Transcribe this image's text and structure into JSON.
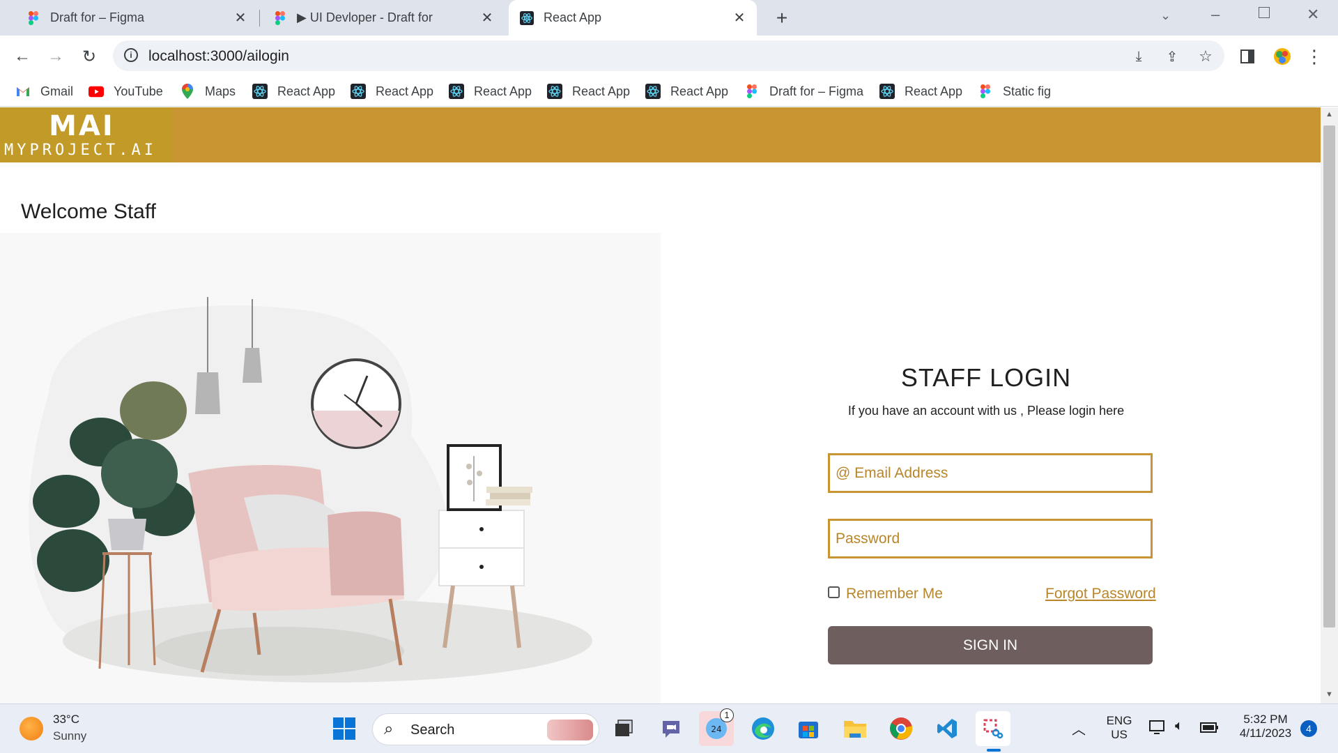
{
  "browser": {
    "tabs": [
      {
        "title": "Draft for – Figma",
        "icon": "figma-icon"
      },
      {
        "title": "▶ UI Devloper - Draft for",
        "icon": "figma-icon"
      },
      {
        "title": "React App",
        "icon": "react-icon",
        "active": true
      }
    ],
    "url": "localhost:3000/ailogin",
    "bookmarks": [
      {
        "label": "Gmail",
        "icon": "gmail-icon"
      },
      {
        "label": "YouTube",
        "icon": "youtube-icon"
      },
      {
        "label": "Maps",
        "icon": "maps-icon"
      },
      {
        "label": "React App",
        "icon": "react-icon"
      },
      {
        "label": "React App",
        "icon": "react-icon"
      },
      {
        "label": "React App",
        "icon": "react-icon"
      },
      {
        "label": "React App",
        "icon": "react-icon"
      },
      {
        "label": "React App",
        "icon": "react-icon"
      },
      {
        "label": "Draft for – Figma",
        "icon": "figma-icon"
      },
      {
        "label": "React App",
        "icon": "react-icon"
      },
      {
        "label": "Static fig",
        "icon": "figma-icon"
      }
    ]
  },
  "page": {
    "logo": {
      "main": "MAI",
      "sub": "MYPROJECT.AI"
    },
    "welcome": "Welcome Staff",
    "login": {
      "title": "STAFF LOGIN",
      "subtitle": "If you have an account with us , Please login here",
      "email_placeholder": "@ Email Address",
      "password_placeholder": "Password",
      "remember_label": "Remember Me",
      "forgot_label": "Forgot Password",
      "signin_label": "SIGN IN"
    }
  },
  "colors": {
    "header": "#c99432",
    "accent": "#b8862a",
    "signin_button": "#6e5f5e"
  },
  "taskbar": {
    "weather": {
      "temp": "33°C",
      "condition": "Sunny"
    },
    "search_label": "Search",
    "chat_badge": "1",
    "language": {
      "line1": "ENG",
      "line2": "US"
    },
    "time": "5:32 PM",
    "date": "4/11/2023",
    "notification_count": "4"
  }
}
